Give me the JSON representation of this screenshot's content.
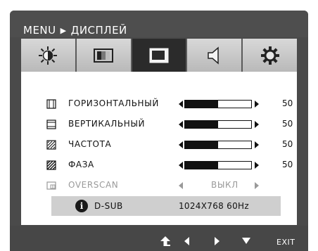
{
  "header": {
    "menu": "MENU",
    "section": "ДИСПЛЕЙ"
  },
  "tabs": [
    {
      "icon": "brightness-icon",
      "active": false
    },
    {
      "icon": "picture-icon",
      "active": false
    },
    {
      "icon": "display-icon",
      "active": true
    },
    {
      "icon": "audio-icon",
      "active": false
    },
    {
      "icon": "settings-icon",
      "active": false
    }
  ],
  "rows": [
    {
      "icon": "horizontal-position-icon",
      "label": "ГОРИЗОНТАЛЬНЫЙ",
      "value": "50",
      "level": 50
    },
    {
      "icon": "vertical-position-icon",
      "label": "ВЕРТИКАЛЬНЫЙ",
      "value": "50",
      "level": 50
    },
    {
      "icon": "clock-icon",
      "label": "ЧАСТОТА",
      "value": "50",
      "level": 50
    },
    {
      "icon": "phase-icon",
      "label": "ФАЗА",
      "value": "50",
      "level": 50
    }
  ],
  "overscan": {
    "label": "OVERSCAN",
    "value": "ВЫКЛ",
    "disabled": true
  },
  "info": {
    "source": "D-SUB",
    "resolution": "1024X768  60Hz"
  },
  "footer": {
    "exit_label": "EXIT"
  },
  "colors": {
    "frame": "#4a4a4a",
    "active_tab": "#2b2b2b",
    "info_bar": "#cfcfcf",
    "disabled_text": "#9a9a9a"
  }
}
